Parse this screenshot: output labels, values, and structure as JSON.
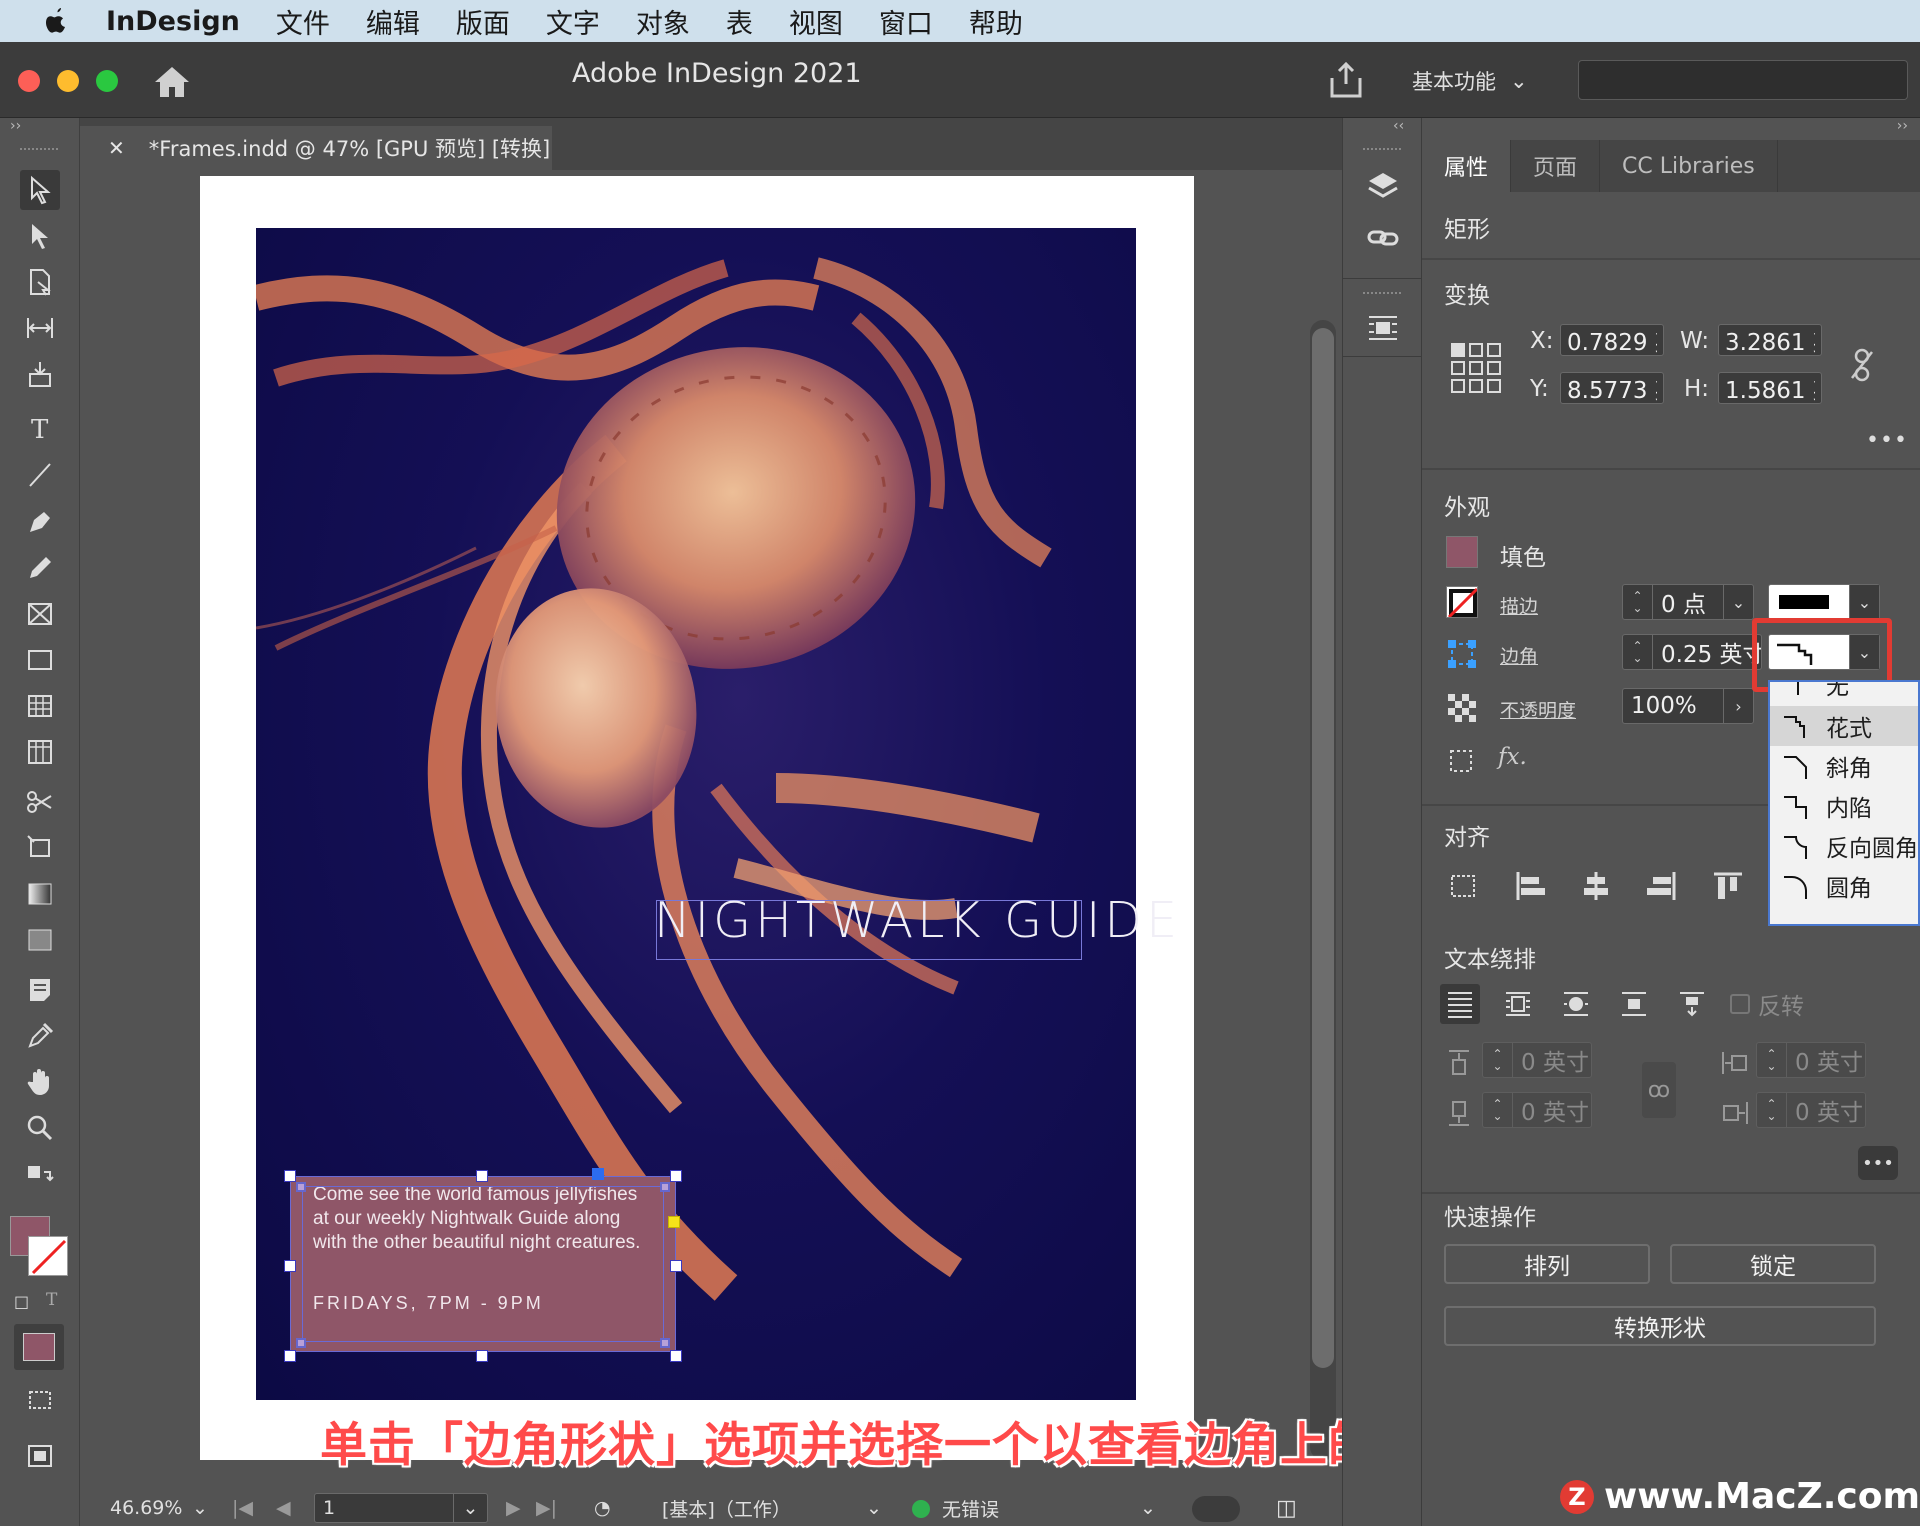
{
  "menubar": {
    "app_name": "InDesign",
    "items": [
      "文件",
      "编辑",
      "版面",
      "文字",
      "对象",
      "表",
      "视图",
      "窗口",
      "帮助"
    ]
  },
  "titlebar": {
    "title": "Adobe InDesign 2021",
    "workspace": "基本功能"
  },
  "document": {
    "tab_label": "*Frames.indd @ 47% [GPU 预览] [转换]",
    "headline": "NIGHTWALK GUIDE",
    "body_text": "Come see the world famous jellyfishes at our weekly Nightwalk Guide along with the other beautiful night creatures.",
    "schedule_text": "FRIDAYS, 7PM - 9PM"
  },
  "caption": "单击「边角形状」选项并选择一个以查看边角上的效果",
  "statusbar": {
    "zoom": "46.69%",
    "page": "1",
    "master": "[基本]（工作）",
    "preflight": "无错误"
  },
  "panel": {
    "tabs": [
      "属性",
      "页面",
      "CC Libraries"
    ],
    "object_type": "矩形",
    "transform": {
      "title": "变换",
      "x_label": "X:",
      "x": "0.7829 英",
      "y_label": "Y:",
      "y": "8.5773 英",
      "w_label": "W:",
      "w": "3.2861 英",
      "h_label": "H:",
      "h": "1.5861 英"
    },
    "appearance": {
      "title": "外观",
      "fill_label": "填色",
      "stroke_label": "描边",
      "stroke_value": "0 点",
      "corner_label": "边角",
      "corner_value": "0.25 英寸",
      "opacity_label": "不透明度",
      "opacity_value": "100%",
      "fx_label": "fx."
    },
    "align": {
      "title": "对齐"
    },
    "text_wrap": {
      "title": "文本绕排",
      "invert_label": "反转",
      "top": "0 英寸",
      "bottom": "0 英寸",
      "left": "0 英寸",
      "right": "0 英寸"
    },
    "quick_actions": {
      "title": "快速操作",
      "arrange": "排列",
      "lock": "锁定",
      "convert_shape": "转换形状"
    }
  },
  "corner_menu": [
    "无",
    "花式",
    "斜角",
    "内陷",
    "反向圆角",
    "圆角"
  ],
  "watermark": "www.MacZ.com",
  "colors": {
    "fill_swatch": "#8f5668",
    "highlight": "#e23b33",
    "canvas_bg": "#535353"
  }
}
